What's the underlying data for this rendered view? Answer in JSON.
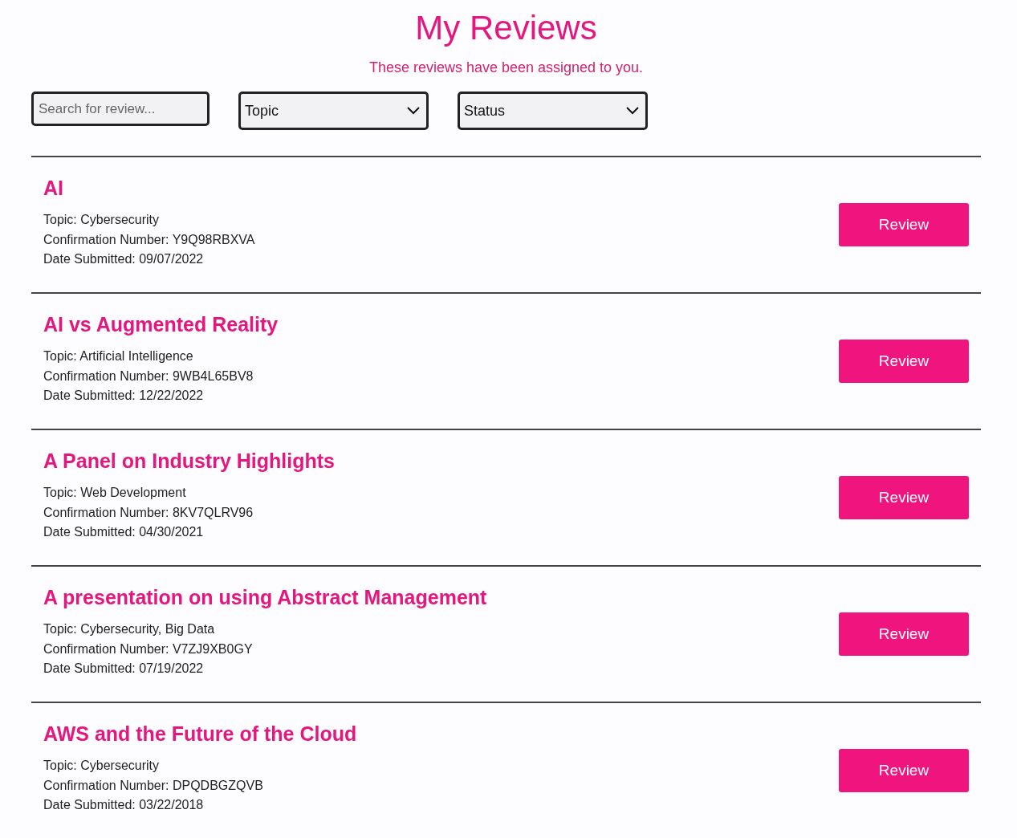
{
  "header": {
    "title": "My Reviews",
    "subtitle": "These reviews have been assigned to you."
  },
  "filters": {
    "search": {
      "placeholder": "Search for review..."
    },
    "dropdowns": [
      {
        "value": "Topic"
      },
      {
        "value": "Status"
      }
    ]
  },
  "reviews": [
    {
      "title": "AI",
      "topic": "Topic: Cybersecurity",
      "confirmation": "Confirmation Number: Y9Q98RBXVA",
      "date": "Date Submitted: 09/07/2022",
      "button": "Review"
    },
    {
      "title": "AI vs Augmented Reality",
      "topic": "Topic: Artificial Intelligence",
      "confirmation": "Confirmation Number: 9WB4L65BV8",
      "date": "Date Submitted: 12/22/2022",
      "button": "Review"
    },
    {
      "title": "A Panel on Industry Highlights",
      "topic": "Topic: Web Development",
      "confirmation": "Confirmation Number: 8KV7QLRV96",
      "date": "Date Submitted: 04/30/2021",
      "button": "Review"
    },
    {
      "title": "A presentation on using Abstract Management",
      "topic": "Topic: Cybersecurity, Big Data",
      "confirmation": "Confirmation Number: V7ZJ9XB0GY",
      "date": "Date Submitted: 07/19/2022",
      "button": "Review"
    },
    {
      "title": "AWS and the Future of the Cloud",
      "topic": "Topic: Cybersecurity",
      "confirmation": "Confirmation Number: DPQDBGZQVB",
      "date": "Date Submitted: 03/22/2018",
      "button": "Review"
    }
  ]
}
